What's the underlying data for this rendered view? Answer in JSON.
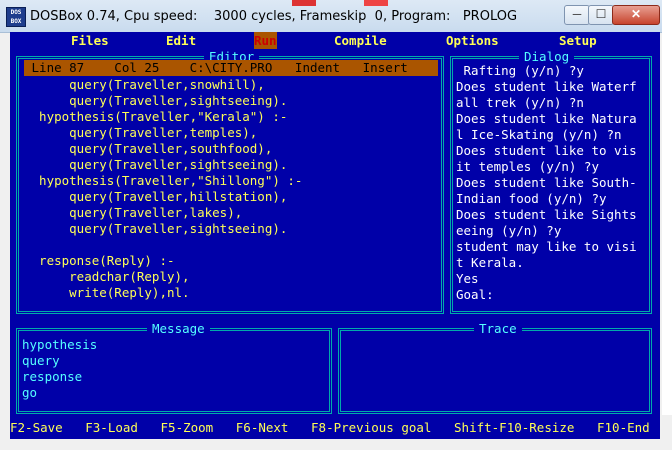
{
  "window": {
    "title": "DOSBox 0.74, Cpu speed:    3000 cycles, Frameskip  0, Program:   PROLOG",
    "icon": "DOS BOX",
    "min_icon": "minimize-icon",
    "max_icon": "maximize-icon",
    "close_icon": "close-icon",
    "min_glyph": "─",
    "max_glyph": "☐",
    "close_glyph": "✕"
  },
  "menu": [
    "Files",
    "Edit",
    "Run",
    "Compile",
    "Options",
    "Setup"
  ],
  "editor": {
    "title": "Editor",
    "status": " Line 87    Col 25    C:\\CITY.PRO   Indent   Insert",
    "lines": [
      "      query(Traveller,snowhill),",
      "      query(Traveller,sightseeing).",
      "  hypothesis(Traveller,\"Kerala\") :-",
      "      query(Traveller,temples),",
      "      query(Traveller,southfood),",
      "      query(Traveller,sightseeing).",
      "  hypothesis(Traveller,\"Shillong\") :-",
      "      query(Traveller,hillstation),",
      "      query(Traveller,lakes),",
      "      query(Traveller,sightseeing).",
      "",
      "  response(Reply) :-",
      "      readchar(Reply),",
      "      write(Reply),nl."
    ]
  },
  "dialog": {
    "title": "Dialog",
    "lines": [
      " Rafting (y/n) ?y",
      "Does student like Waterf",
      "all trek (y/n) ?n",
      "Does student like Natura",
      "l Ice-Skating (y/n) ?n",
      "Does student like to vis",
      "it temples (y/n) ?y",
      "Does student like South-",
      "Indian food (y/n) ?y",
      "Does student like Sights",
      "eeing (y/n) ?y",
      "student may like to visi",
      "t Kerala.",
      "Yes",
      "Goal:"
    ]
  },
  "message": {
    "title": "Message",
    "lines": [
      "hypothesis",
      "query",
      "response",
      "go"
    ]
  },
  "trace": {
    "title": "Trace"
  },
  "fkeys": "F2-Save   F3-Load   F5-Zoom   F6-Next   F8-Previous goal   Shift-F10-Resize   F10-End"
}
